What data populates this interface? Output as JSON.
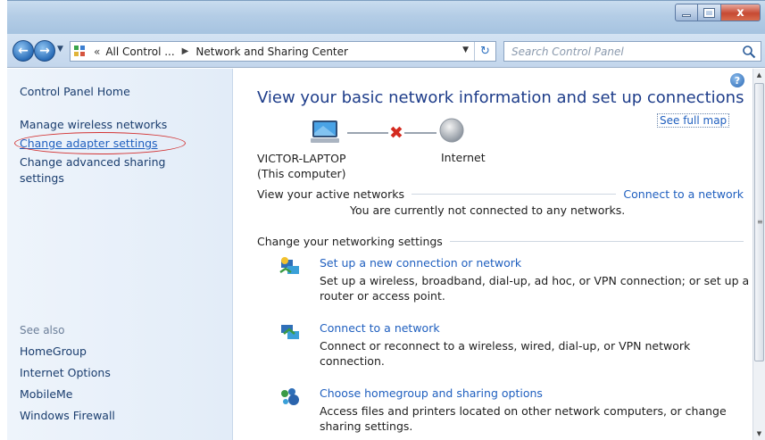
{
  "window": {
    "minimize_label": "",
    "maximize_label": "",
    "close_label": "x"
  },
  "addressbar": {
    "back": "←",
    "forward": "→",
    "breadcrumb_root": "All Control ...",
    "breadcrumb_current": "Network and Sharing Center",
    "search_placeholder": "Search Control Panel"
  },
  "sidebar": {
    "home": "Control Panel Home",
    "tasks": [
      {
        "label": "Manage wireless networks"
      },
      {
        "label": "Change adapter settings",
        "highlighted": true
      },
      {
        "label": "Change advanced sharing\nsettings"
      }
    ],
    "see_also_header": "See also",
    "see_also": [
      {
        "label": "HomeGroup"
      },
      {
        "label": "Internet Options"
      },
      {
        "label": "MobileMe"
      },
      {
        "label": "Windows Firewall"
      }
    ],
    "highlight_color": "#d33333"
  },
  "main": {
    "title": "View your basic network information and set up connections",
    "see_full_map": "See full map",
    "computer_name": "VICTOR-LAPTOP",
    "computer_sub": "(This computer)",
    "internet_label": "Internet",
    "active_networks_header": "View your active networks",
    "connect_link": "Connect to a network",
    "no_connection": "You are currently not connected to any networks.",
    "change_settings_header": "Change your networking settings",
    "tasks": [
      {
        "icon": "new-connection-icon",
        "link": "Set up a new connection or network",
        "desc": "Set up a wireless, broadband, dial-up, ad hoc, or VPN connection; or set up a router or access point."
      },
      {
        "icon": "connect-network-icon",
        "link": "Connect to a network",
        "desc": "Connect or reconnect to a wireless, wired, dial-up, or VPN network connection."
      },
      {
        "icon": "homegroup-icon",
        "link": "Choose homegroup and sharing options",
        "desc": "Access files and printers located on other network computers, or change sharing settings."
      }
    ]
  },
  "colors": {
    "link": "#1f5fbf",
    "title": "#1e3d8a",
    "error_x": "#d42a1f"
  }
}
